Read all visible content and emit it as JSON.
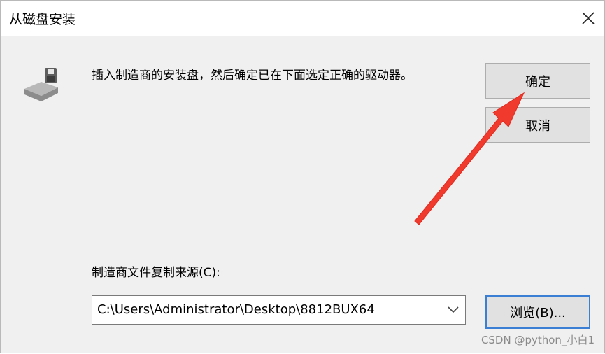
{
  "window": {
    "title": "从磁盘安装"
  },
  "dialog": {
    "message": "插入制造商的安装盘，然后确定已在下面选定正确的驱动器。",
    "ok_label": "确定",
    "cancel_label": "取消",
    "source_label": "制造商文件复制来源(C):",
    "source_path": "C:\\Users\\Administrator\\Desktop\\8812BUX64",
    "browse_label": "浏览(B)..."
  },
  "overlay": {
    "watermark": "CSDN @python_小白1",
    "arrow_color": "#f03a2e"
  },
  "icons": [
    "close-icon",
    "floppy-disk-icon",
    "chevron-down-icon"
  ]
}
